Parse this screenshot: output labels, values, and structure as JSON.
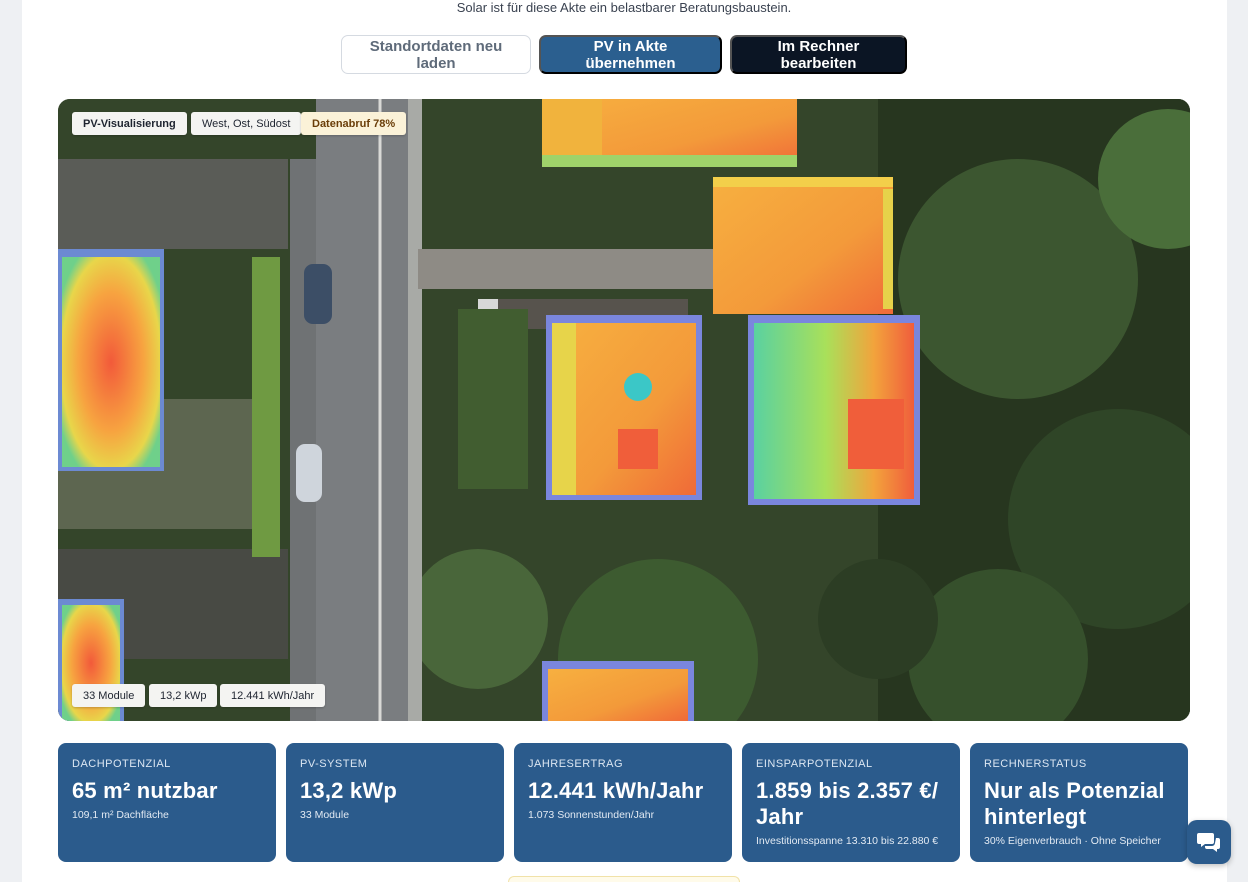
{
  "intro": "Solar ist für diese Akte ein belastbarer Beratungsbaustein.",
  "actions": {
    "reload": "Standortdaten neu laden",
    "apply": "PV in Akte übernehmen",
    "edit": "Im Rechner bearbeiten"
  },
  "viz": {
    "chip_title": "PV-Visualisierung",
    "chip_orientation": "West, Ost, Südost",
    "chip_progress": "Datenabruf 78%",
    "progress_value": 0.78,
    "chip_modules": "33 Module",
    "chip_power": "13,2 kWp",
    "chip_yield": "12.441 kWh/Jahr"
  },
  "stats": [
    {
      "label": "DACHPOTENZIAL",
      "value": "65 m² nutzbar",
      "sub": "109,1 m² Dachfläche"
    },
    {
      "label": "PV-SYSTEM",
      "value": "13,2 kWp",
      "sub": "33 Module"
    },
    {
      "label": "JAHRESERTRAG",
      "value": "12.441 kWh/Jahr",
      "sub": "1.073 Sonnenstunden/Jahr"
    },
    {
      "label": "EINSPARPOTENZIAL",
      "value": "1.859 bis 2.357 €/ Jahr",
      "sub": "Investitionsspanne 13.310 bis 22.880 €"
    },
    {
      "label": "RECHNERSTATUS",
      "value": "Nur als Potenzial hinterlegt",
      "sub": "30% Eigenverbrauch · Ohne Speicher"
    }
  ],
  "colors": {
    "primary": "#2b5f8f",
    "dark": "#0b1524",
    "card": "#2b5b8c"
  },
  "icons": {
    "chat": "chat-bubbles-icon"
  }
}
